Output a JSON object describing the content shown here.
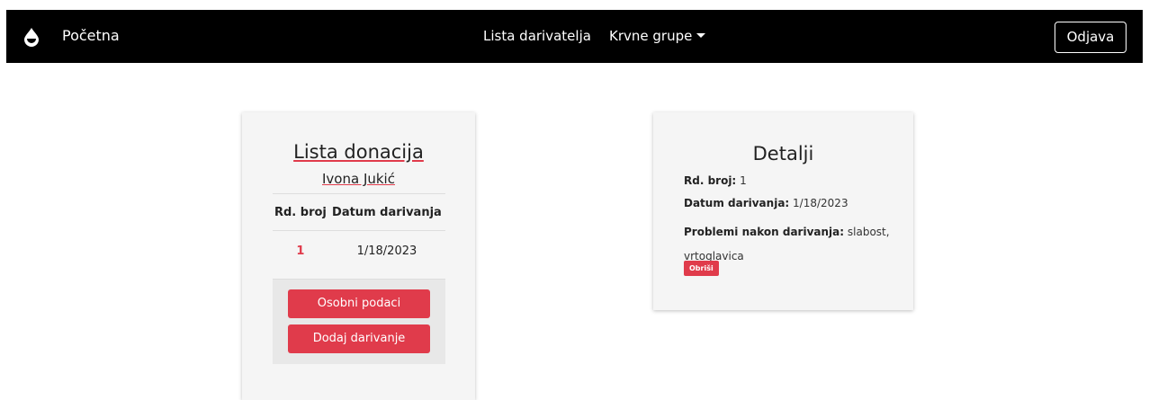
{
  "navbar": {
    "brand": "Početna",
    "links": [
      "Lista darivatelja",
      "Krvne grupe"
    ],
    "logout": "Odjava"
  },
  "left_card": {
    "title": "Lista donacija",
    "donor_name": "Ivona Jukić",
    "table": {
      "headers": [
        "Rd. broj",
        "Datum darivanja"
      ],
      "rows": [
        [
          "1",
          "1/18/2023"
        ]
      ]
    },
    "buttons": {
      "personal": "Osobni podaci",
      "add": "Dodaj darivanje"
    }
  },
  "right_card": {
    "title": "Detalji",
    "rd_label": "Rd. broj:",
    "rd_value": "1",
    "date_label": "Datum darivanja:",
    "date_value": "1/18/2023",
    "problems_label": "Problemi nakon darivanja:",
    "problems_value": "slabost, vrtoglavica",
    "delete": "Obriši"
  },
  "colors": {
    "accent": "#e03b4b",
    "navbar": "#000000",
    "card": "#f5f5f5"
  }
}
